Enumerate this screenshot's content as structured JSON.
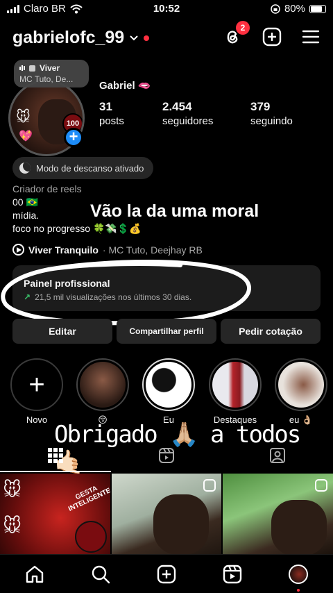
{
  "status": {
    "carrier": "Claro BR",
    "time": "10:52",
    "battery": "80%"
  },
  "header": {
    "username": "gabrielofc_99",
    "threads_badge": "2",
    "icons": [
      "threads-icon",
      "create-post-icon",
      "menu-icon"
    ]
  },
  "note": {
    "title": "Viver",
    "subtitle": "MC Tuto, De..."
  },
  "profile": {
    "display_name": "Gabriel 🫦",
    "stats": [
      {
        "value": "31",
        "label": "posts"
      },
      {
        "value": "2.454",
        "label": "seguidores"
      },
      {
        "value": "379",
        "label": "seguindo"
      }
    ],
    "avatar_badge": "100"
  },
  "rest_mode": "Modo de descanso ativado",
  "bio": {
    "category": "Criador de reels",
    "line1": "00 🇧🇷",
    "line2": "mídia.",
    "line3": "foco no progresso 🍀💸💲💰"
  },
  "overlay_text_top": "Vão la da uma moral",
  "music": {
    "song": "Viver Tranquilo",
    "artist": "· MC Tuto, Deejhay RB"
  },
  "panel": {
    "title": "Painel profissional",
    "stat": "21,5 mil visualizações nos últimos 30 dias."
  },
  "buttons": {
    "edit": "Editar",
    "share": "Compartilhar perfil",
    "quote": "Pedir cotação"
  },
  "highlights": [
    {
      "label": "Novo"
    },
    {
      "label": "😚"
    },
    {
      "label": "Eu"
    },
    {
      "label": "Destaques"
    },
    {
      "label": "eu 👌🏼"
    }
  ],
  "overlay_text_bottom": "Obrigado 🙏🏼 a todos 🤙🏻",
  "tabs": [
    "grid-icon",
    "reels-icon",
    "tagged-icon"
  ],
  "grid_post_text": "GESTA INTELIGENTE",
  "colors": {
    "accent_blue": "#1d8cf8",
    "notification_red": "#ff3040",
    "growth_green": "#3bc46b"
  }
}
